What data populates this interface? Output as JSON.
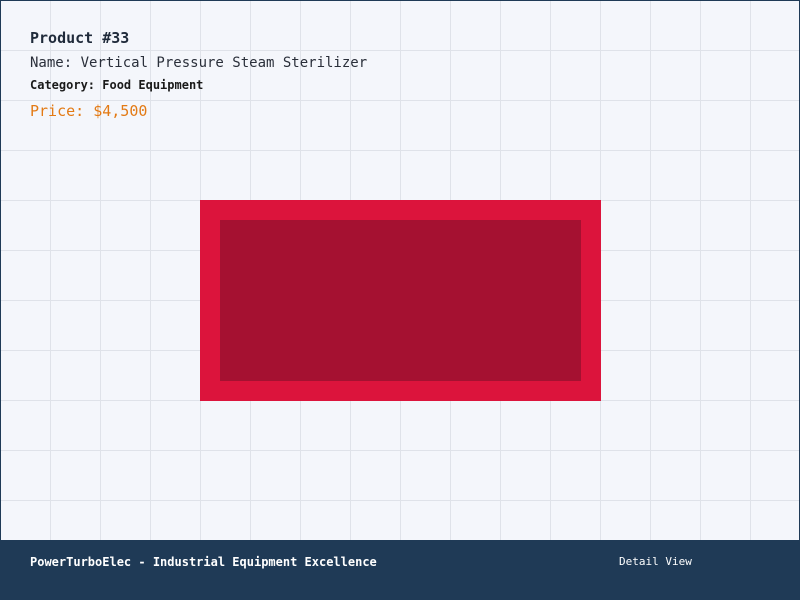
{
  "product": {
    "id_label": "Product #33",
    "name_label": "Name: Vertical Pressure Steam Sterilizer",
    "category_label": "Category: Food Equipment",
    "price_label": "Price: $4,500"
  },
  "footer": {
    "brand": "PowerTurboElec - Industrial Equipment Excellence",
    "view_label": "Detail View"
  },
  "colors": {
    "image_outer": "#dc143c",
    "image_inner": "#a51131",
    "price": "#e37a14",
    "footer_bg": "#1f3a56"
  }
}
